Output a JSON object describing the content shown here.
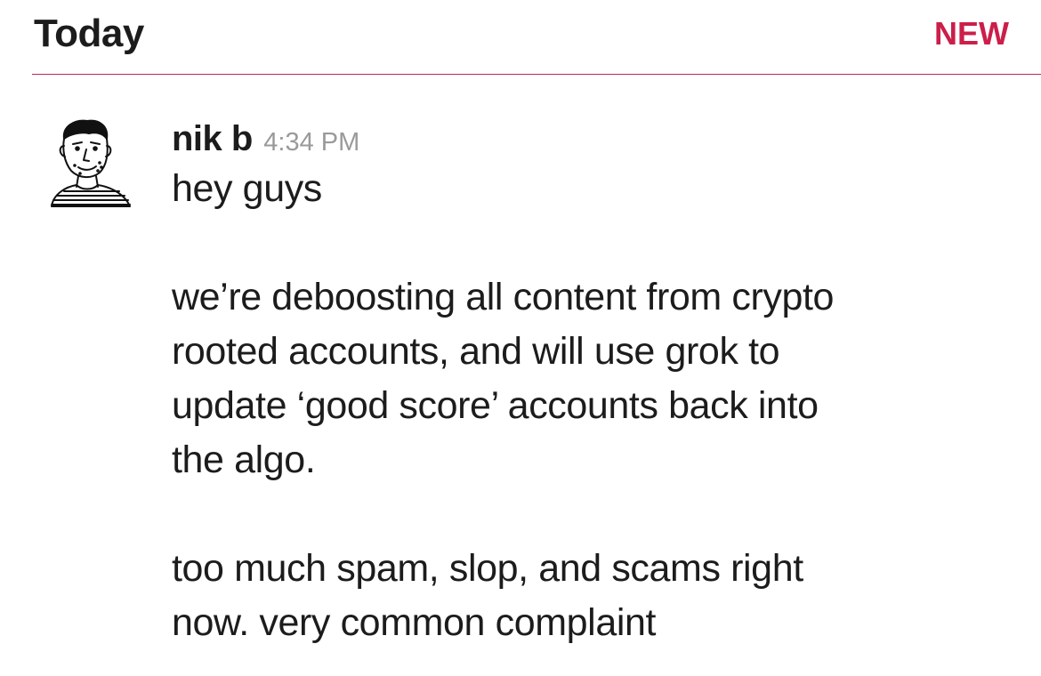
{
  "header": {
    "day_label": "Today",
    "new_label": "NEW"
  },
  "colors": {
    "accent": "#cc1e4a",
    "divider": "#c0245e",
    "timestamp": "#9a9a9a",
    "text": "#1d1c1d"
  },
  "message": {
    "avatar_icon": "sketch-portrait-avatar",
    "sender": "nik b",
    "time": "4:34 PM",
    "paragraphs": [
      {
        "lines": [
          "hey guys"
        ]
      },
      {
        "lines": [
          "we’re deboosting all content from crypto",
          "rooted accounts, and will use grok to",
          "update ‘good score’ accounts back into",
          "the algo."
        ]
      },
      {
        "lines": [
          "too much spam, slop, and scams right",
          "now. very common complaint"
        ]
      }
    ]
  }
}
